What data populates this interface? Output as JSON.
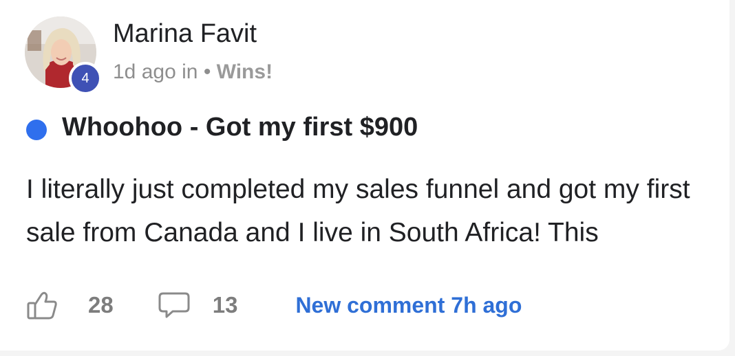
{
  "post": {
    "author": {
      "name": "Marina Favit",
      "level": "4"
    },
    "meta": {
      "time": "1d ago",
      "in_label": "in",
      "separator": "•",
      "category": "Wins!"
    },
    "title": "Whoohoo - Got my first $900",
    "body": "I literally just completed my sales funnel and got my first sale from Canada and I live in South Africa! This",
    "likes": "28",
    "comments": "13",
    "new_comment": "New comment 7h ago",
    "unread": true
  },
  "colors": {
    "unread_dot": "#2f6fed",
    "level_badge": "#3f51b5",
    "new_comment": "#2f6fd6"
  },
  "icons": {
    "like": "thumbs-up-icon",
    "comment": "speech-bubble-icon"
  }
}
